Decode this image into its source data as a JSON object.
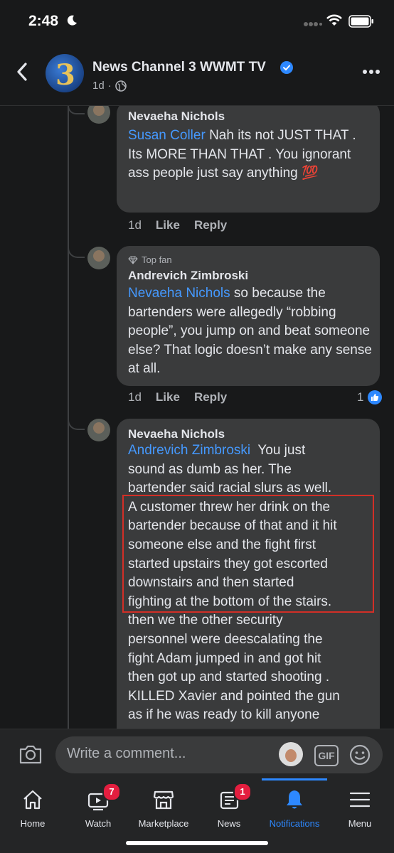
{
  "status": {
    "time": "2:48"
  },
  "header": {
    "page_name": "News Channel 3 WWMT TV",
    "age": "1d",
    "logo_text": "3"
  },
  "comments": [
    {
      "author": "Nevaeha Nichols",
      "mention": "Susan Coller",
      "text": "Nah its not JUST THAT . Its MORE THAN THAT . You ignorant ass people just say anything",
      "emoji": "💯",
      "age": "1d",
      "like": "Like",
      "reply": "Reply"
    },
    {
      "badge": "Top fan",
      "author": "Andrevich Zimbroski",
      "mention": "Nevaeha Nichols",
      "text": "so because the bartenders were allegedly “robbing people”, you jump on and beat someone else? That logic doesn’t make any sense at all.",
      "age": "1d",
      "like": "Like",
      "reply": "Reply",
      "reactions": "1"
    },
    {
      "author": "Nevaeha Nichols",
      "mention": "Andrevich Zimbroski",
      "text_lines": [
        "You just",
        "sound as dumb as her. The",
        "bartender said racial slurs as well.",
        "A customer threw her drink on the",
        "bartender because of that and it hit",
        "someone else and the fight first",
        "started upstairs they got escorted",
        "downstairs and then started",
        "fighting at the bottom of the stairs.",
        "then we the other security",
        "personnel were deescalating the",
        "fight Adam jumped in and got hit",
        "then got up and started shooting .",
        "KILLED Xavier and pointed the gun",
        "as if he was ready to kill anyone"
      ]
    }
  ],
  "composer": {
    "placeholder": "Write a comment...",
    "gif": "GIF"
  },
  "tabs": [
    {
      "label": "Home"
    },
    {
      "label": "Watch",
      "badge": "7"
    },
    {
      "label": "Marketplace"
    },
    {
      "label": "News",
      "badge": "1"
    },
    {
      "label": "Notifications"
    },
    {
      "label": "Menu"
    }
  ],
  "colors": {
    "background": "#18191a",
    "bubble": "#3a3b3c",
    "mention": "#4599ff",
    "accent": "#2d88ff",
    "highlight_box": "#d22f27",
    "badge": "#e41e3f"
  },
  "icons": [
    "moon-icon",
    "signal-icon",
    "wifi-icon",
    "battery-icon",
    "back-icon",
    "verified-icon",
    "globe-icon",
    "more-icon",
    "diamond-icon",
    "like-reaction-icon",
    "camera-icon",
    "gif-icon",
    "emoji-icon",
    "home-icon",
    "watch-icon",
    "marketplace-icon",
    "news-icon",
    "bell-icon",
    "menu-icon"
  ]
}
